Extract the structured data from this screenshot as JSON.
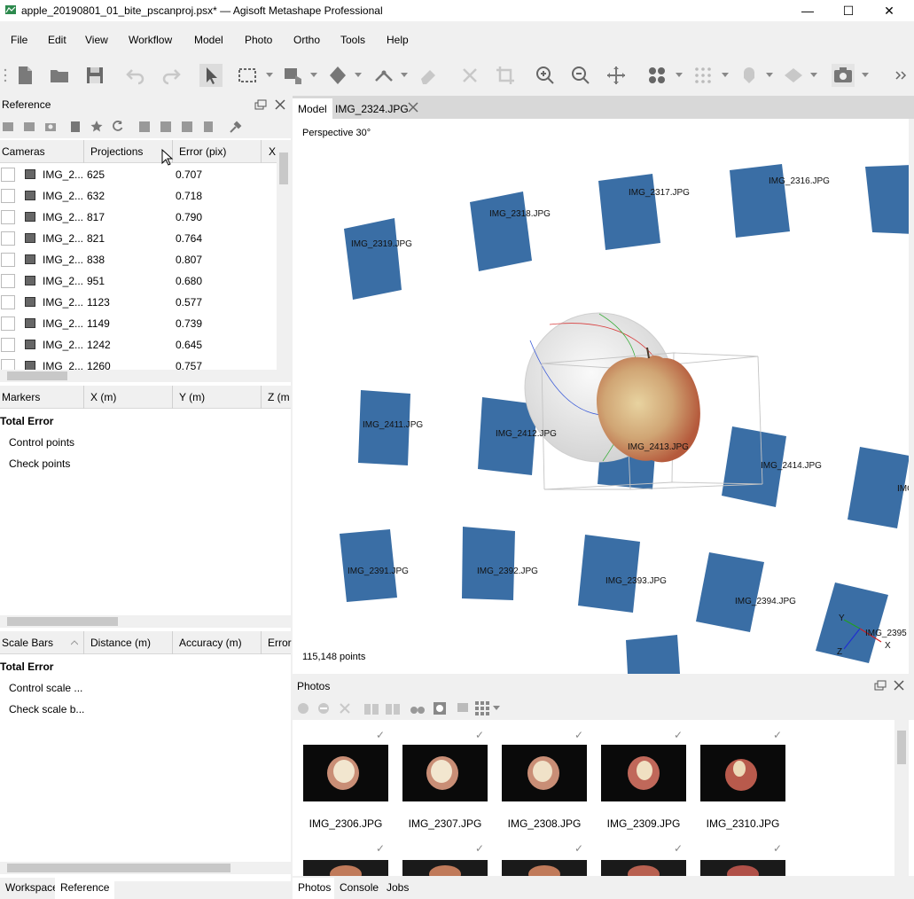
{
  "window": {
    "title": "apple_20190801_01_bite_pscanproj.psx* — Agisoft Metashape Professional",
    "minimize_glyph": "—",
    "maximize_glyph": "☐",
    "close_glyph": "✕"
  },
  "menu": [
    "File",
    "Edit",
    "View",
    "Workflow",
    "Model",
    "Photo",
    "Ortho",
    "Tools",
    "Help"
  ],
  "toolbar": {
    "icons": [
      "new-document-icon",
      "open-folder-icon",
      "save-icon",
      "undo-icon",
      "redo-icon",
      "select-arrow-icon",
      "rectangle-select-icon",
      "move-region-icon",
      "rotate-object-icon",
      "ruler-icon",
      "eraser-icon",
      "delete-icon",
      "crop-icon",
      "zoom-in-icon",
      "zoom-out-icon",
      "reset-view-icon",
      "show-cameras-icon",
      "show-points-icon",
      "show-model-icon",
      "show-texture-icon",
      "capture-view-icon"
    ]
  },
  "reference_panel": {
    "title": "Reference",
    "cameras_table": {
      "headers": [
        "Cameras",
        "Projections",
        "Error (pix)",
        "X"
      ],
      "rows": [
        {
          "name": "IMG_2...",
          "projections": "625",
          "error": "0.707"
        },
        {
          "name": "IMG_2...",
          "projections": "632",
          "error": "0.718"
        },
        {
          "name": "IMG_2...",
          "projections": "817",
          "error": "0.790"
        },
        {
          "name": "IMG_2...",
          "projections": "821",
          "error": "0.764"
        },
        {
          "name": "IMG_2...",
          "projections": "838",
          "error": "0.807"
        },
        {
          "name": "IMG_2...",
          "projections": "951",
          "error": "0.680"
        },
        {
          "name": "IMG_2...",
          "projections": "1123",
          "error": "0.577"
        },
        {
          "name": "IMG_2...",
          "projections": "1149",
          "error": "0.739"
        },
        {
          "name": "IMG_2...",
          "projections": "1242",
          "error": "0.645"
        },
        {
          "name": "IMG_2...",
          "projections": "1260",
          "error": "0.757"
        }
      ]
    },
    "markers_table": {
      "headers": [
        "Markers",
        "X (m)",
        "Y (m)",
        "Z (m"
      ],
      "total_label": "Total Error",
      "items": [
        "Control points",
        "Check points"
      ]
    },
    "scalebars_table": {
      "headers": [
        "Scale Bars",
        "Distance (m)",
        "Accuracy (m)",
        "Error"
      ],
      "total_label": "Total Error",
      "items": [
        "Control scale ...",
        "Check scale b..."
      ]
    }
  },
  "left_bottom_tabs": [
    "Workspace",
    "Reference"
  ],
  "model_tabs": [
    "Model",
    "IMG_2324.JPG"
  ],
  "model_view": {
    "projection": "Perspective 30°",
    "point_count": "115,148 points",
    "axis_labels": [
      "Y",
      "X",
      "Z"
    ],
    "camera_labels": [
      "IMG_2319.JPG",
      "IMG_2318.JPG",
      "IMG_2317.JPG",
      "IMG_2316.JPG",
      "IMG_2411.JPG",
      "IMG_2412.JPG",
      "IMG_2413.JPG",
      "IMG_2414.JPG",
      "IMG",
      "IMG_2391.JPG",
      "IMG_2392.JPG",
      "IMG_2393.JPG",
      "IMG_2394.JPG",
      "IMG_2395"
    ]
  },
  "photos_panel": {
    "title": "Photos",
    "checkmark": "✓",
    "photos": [
      "IMG_2306.JPG",
      "IMG_2307.JPG",
      "IMG_2308.JPG",
      "IMG_2309.JPG",
      "IMG_2310.JPG"
    ]
  },
  "bottom_tabs": [
    "Photos",
    "Console",
    "Jobs"
  ],
  "colors": {
    "camera_blue": "#3a6ea5",
    "tab_active": "#ffffff",
    "tab_bar": "#d8d8d8"
  }
}
